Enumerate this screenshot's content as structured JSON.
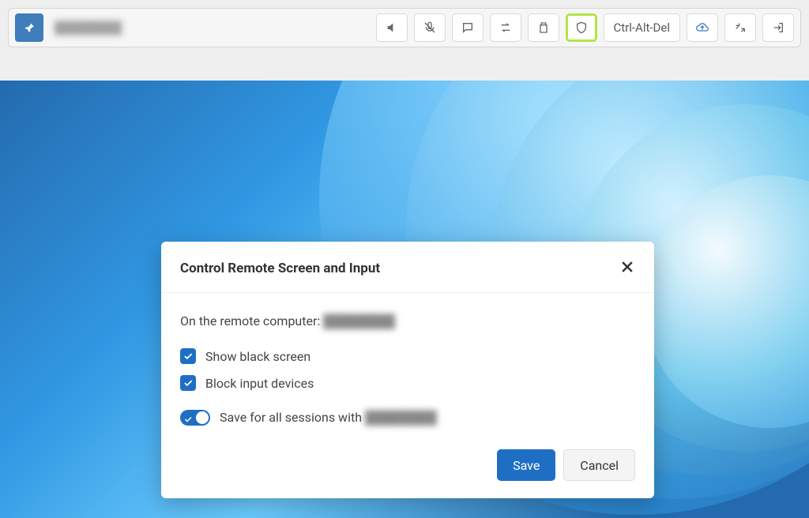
{
  "toolbar": {
    "device_name": "████████",
    "ctrl_alt_del_label": "Ctrl-Alt-Del"
  },
  "modal": {
    "title": "Control Remote Screen and Input",
    "body_line_prefix": "On the remote computer: ",
    "body_line_name": "████████",
    "checkbox1": {
      "label": "Show black screen",
      "checked": true
    },
    "checkbox2": {
      "label": "Block input devices",
      "checked": true
    },
    "toggle": {
      "label_prefix": "Save for all sessions with ",
      "label_name": "████████",
      "on": true
    },
    "save_label": "Save",
    "cancel_label": "Cancel"
  }
}
